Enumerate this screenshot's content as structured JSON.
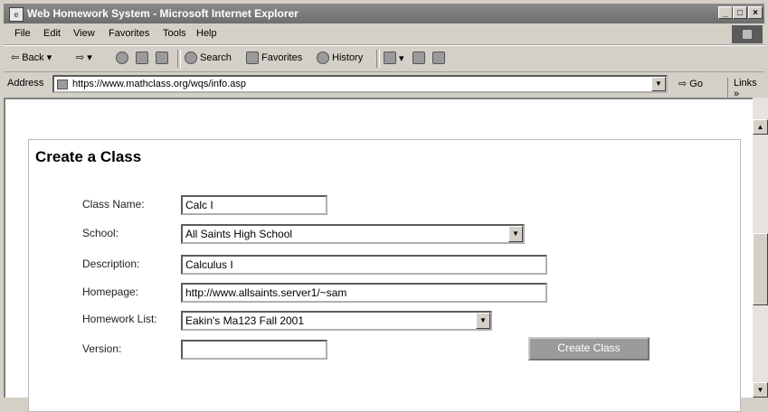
{
  "window": {
    "title": "Web Homework System - Microsoft Internet Explorer",
    "minimize": "_",
    "maximize": "□",
    "close": "×"
  },
  "menu": [
    "File",
    "Edit",
    "View",
    "Favorites",
    "Tools",
    "Help"
  ],
  "toolbar": {
    "back": "Back",
    "forward": "⇨",
    "search": "Search",
    "favorites": "Favorites",
    "history": "History"
  },
  "address": {
    "label": "Address",
    "url": "https://www.mathclass.org/wqs/info.asp",
    "go": "Go",
    "links": "Links"
  },
  "form": {
    "heading": "Create a Class",
    "class_name": {
      "label": "Class Name:",
      "value": "Calc I"
    },
    "school": {
      "label": "School:",
      "value": "All Saints High School"
    },
    "description": {
      "label": "Description:",
      "value": "Calculus I"
    },
    "homepage": {
      "label": "Homepage:",
      "value": "http://www.allsaints.server1/~sam"
    },
    "homework_list": {
      "label": "Homework List:",
      "value": "Eakin's Ma123 Fall 2001"
    },
    "version": {
      "label": "Version:",
      "value": ""
    },
    "submit": "Create Class"
  }
}
